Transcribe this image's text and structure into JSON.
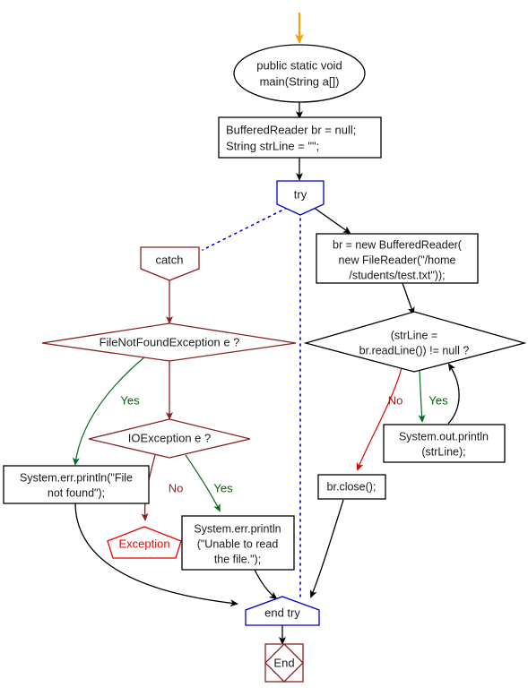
{
  "diagram": {
    "title": "Java try-catch file reading flowchart",
    "colors": {
      "start_arrow": "#f5a20a",
      "black": "#000000",
      "blue": "#0000cc",
      "dark_red": "#8b2222",
      "red": "#ee0000",
      "green": "#0a6b1e"
    },
    "nodes": {
      "entry_arrow": {
        "shape": "arrow",
        "color": "#f5a20a"
      },
      "main": {
        "shape": "ellipse",
        "color": "#000000",
        "lines": [
          "public static void",
          "main(String a[])"
        ]
      },
      "declare": {
        "shape": "rect",
        "color": "#000000",
        "lines": [
          "BufferedReader br = null;",
          "String strLine = \"\";"
        ]
      },
      "try": {
        "shape": "pentagon-down",
        "color": "#0000cc",
        "lines": [
          "try"
        ]
      },
      "catch": {
        "shape": "pentagon-down",
        "color": "#8b2222",
        "lines": [
          "catch"
        ]
      },
      "new_reader": {
        "shape": "rect",
        "color": "#000000",
        "lines": [
          "br = new BufferedReader(",
          "new FileReader(\"/home",
          "/students/test.txt\"));"
        ]
      },
      "fnf_decision": {
        "shape": "diamond",
        "color": "#8b2222",
        "lines": [
          "FileNotFoundException e ?"
        ]
      },
      "readline_decision": {
        "shape": "diamond",
        "color": "#000000",
        "lines": [
          "(strLine =",
          "br.readLine()) != null ?"
        ]
      },
      "io_decision": {
        "shape": "diamond",
        "color": "#8b2222",
        "lines": [
          "IOException e ?"
        ]
      },
      "err_file_not_found": {
        "shape": "rect",
        "color": "#000000",
        "lines": [
          "System.err.println(\"File",
          "not found\");"
        ]
      },
      "exception": {
        "shape": "pentagon-up",
        "color": "#ee0000",
        "lines": [
          "Exception"
        ]
      },
      "err_unable_read": {
        "shape": "rect",
        "color": "#000000",
        "lines": [
          "System.err.println",
          "(\"Unable to read",
          "the file.\");"
        ]
      },
      "out_println": {
        "shape": "rect",
        "color": "#000000",
        "lines": [
          "System.out.println",
          "(strLine);"
        ]
      },
      "br_close": {
        "shape": "rect",
        "color": "#000000",
        "lines": [
          "br.close();"
        ]
      },
      "end_try": {
        "shape": "pentagon-up",
        "color": "#0000cc",
        "lines": [
          "end try"
        ]
      },
      "end": {
        "shape": "square-diamond",
        "color": "#8b2222",
        "lines": [
          "End"
        ]
      }
    },
    "edge_labels": {
      "fnf_yes": "Yes",
      "io_no": "No",
      "io_yes": "Yes",
      "readline_no": "No",
      "readline_yes": "Yes"
    }
  }
}
